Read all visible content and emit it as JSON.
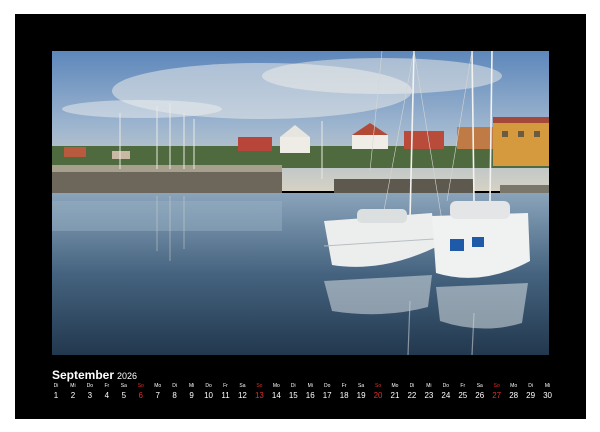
{
  "calendar": {
    "month": "September",
    "year": "2026",
    "days": [
      {
        "wd": "Di",
        "d": "1"
      },
      {
        "wd": "Mi",
        "d": "2"
      },
      {
        "wd": "Do",
        "d": "3"
      },
      {
        "wd": "Fr",
        "d": "4"
      },
      {
        "wd": "Sa",
        "d": "5"
      },
      {
        "wd": "So",
        "d": "6",
        "sun": true
      },
      {
        "wd": "Mo",
        "d": "7"
      },
      {
        "wd": "Di",
        "d": "8"
      },
      {
        "wd": "Mi",
        "d": "9"
      },
      {
        "wd": "Do",
        "d": "10"
      },
      {
        "wd": "Fr",
        "d": "11"
      },
      {
        "wd": "Sa",
        "d": "12"
      },
      {
        "wd": "So",
        "d": "13",
        "sun": true
      },
      {
        "wd": "Mo",
        "d": "14"
      },
      {
        "wd": "Di",
        "d": "15"
      },
      {
        "wd": "Mi",
        "d": "16"
      },
      {
        "wd": "Do",
        "d": "17"
      },
      {
        "wd": "Fr",
        "d": "18"
      },
      {
        "wd": "Sa",
        "d": "19"
      },
      {
        "wd": "So",
        "d": "20",
        "sun": true
      },
      {
        "wd": "Mo",
        "d": "21"
      },
      {
        "wd": "Di",
        "d": "22"
      },
      {
        "wd": "Mi",
        "d": "23"
      },
      {
        "wd": "Do",
        "d": "24"
      },
      {
        "wd": "Fr",
        "d": "25"
      },
      {
        "wd": "Sa",
        "d": "26"
      },
      {
        "wd": "So",
        "d": "27",
        "sun": true
      },
      {
        "wd": "Mo",
        "d": "28"
      },
      {
        "wd": "Di",
        "d": "29"
      },
      {
        "wd": "Mi",
        "d": "30"
      }
    ]
  },
  "colors": {
    "sunday": "#e0302a",
    "frame": "#000000",
    "text": "#ffffff"
  }
}
